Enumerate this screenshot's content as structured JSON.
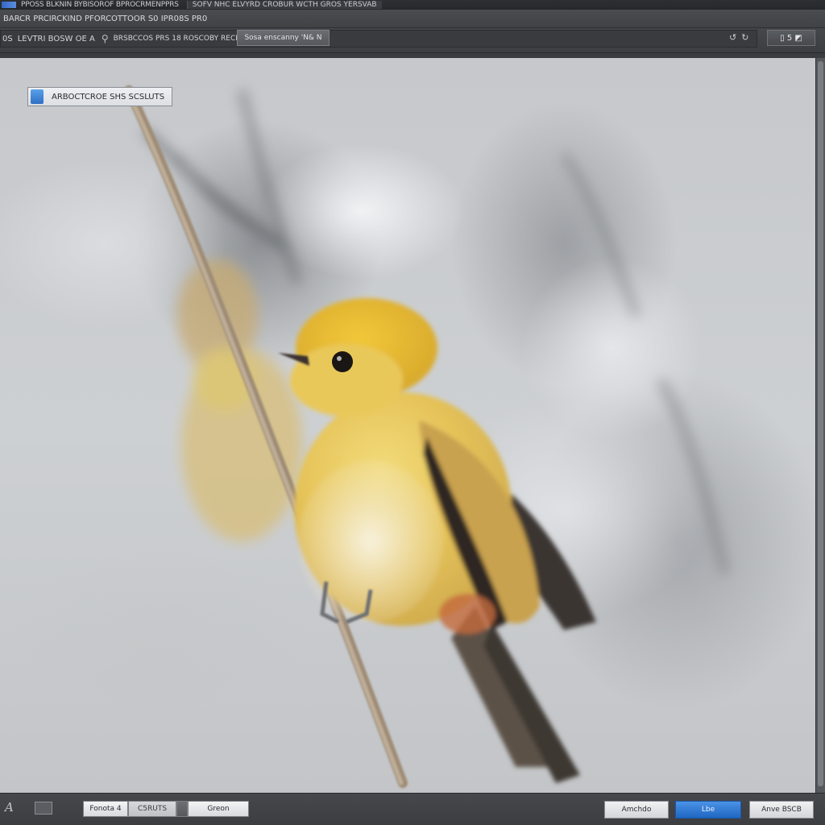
{
  "window": {
    "title": "PPOSS BLKNIN BYBISOROF BPROCRMENPPRS",
    "tab_title": "SOFV NHC ELVYRD CROBUR WCTH GROS YERSVAB",
    "menu": "BARCR PRCIRCKIND PFORCOTTOOR S0 IPR08S PR0"
  },
  "toolbar": {
    "path_prefix": "0S",
    "path_text": "LEVTRI BOSW OE  A",
    "path_text2": "BRSBCCOS PRS 18 ROSCOBY RECRIVES Ave",
    "crumb_label": "Sosa enscanny 'N& N",
    "back_icon": "↺",
    "refresh_icon": "↻",
    "view_label": "▯ 5 ◩"
  },
  "preview": {
    "overlay_label": "ARBOCTCROE SHS SCSLUTS"
  },
  "bottom": {
    "pen_icon": "A",
    "segments": [
      "Fonota 4",
      "C5RUTS",
      "Greon"
    ],
    "buttons": {
      "secondary": "Amchdo",
      "primary": "Lbe",
      "tertiary": "Anve BSCB"
    }
  },
  "colors": {
    "primary_button": "#1f66c2",
    "chrome": "#3a3c3f"
  }
}
